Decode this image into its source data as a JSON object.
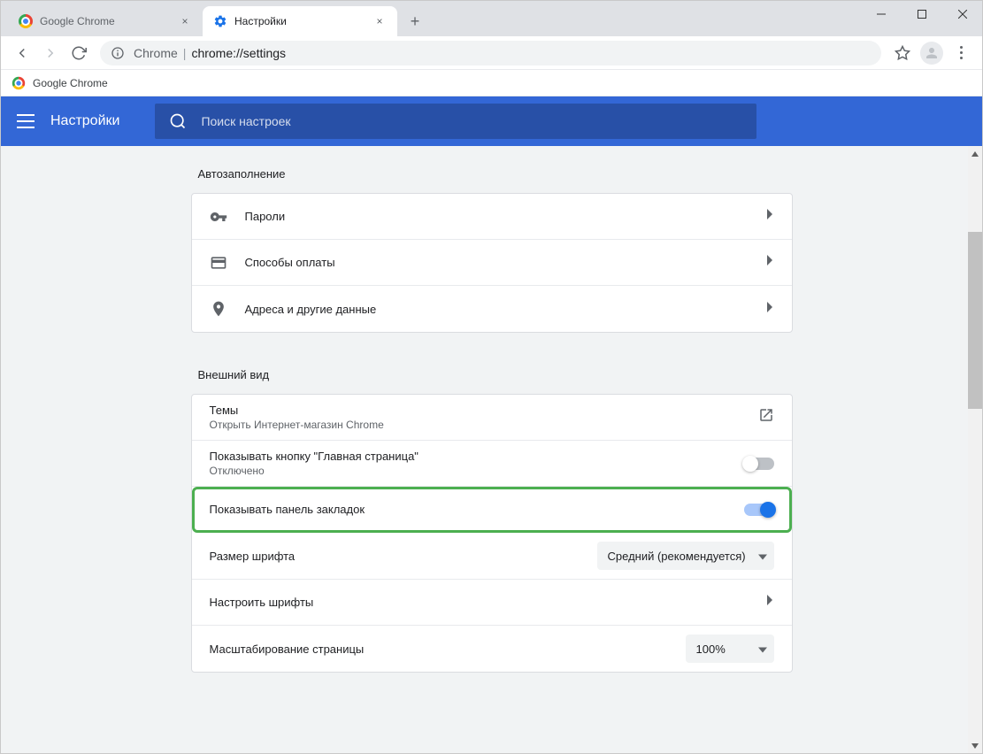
{
  "window": {
    "tabs": [
      {
        "title": "Google Chrome"
      },
      {
        "title": "Настройки"
      }
    ]
  },
  "addressbar": {
    "scheme_label": "Chrome",
    "url": "chrome://settings"
  },
  "bookmarks": {
    "item0": "Google Chrome"
  },
  "header": {
    "title": "Настройки",
    "search_placeholder": "Поиск настроек"
  },
  "sections": {
    "autofill": {
      "title": "Автозаполнение",
      "passwords": "Пароли",
      "payments": "Способы оплаты",
      "addresses": "Адреса и другие данные"
    },
    "appearance": {
      "title": "Внешний вид",
      "themes": {
        "label": "Темы",
        "sublabel": "Открыть Интернет-магазин Chrome"
      },
      "home_button": {
        "label": "Показывать кнопку \"Главная страница\"",
        "sublabel": "Отключено",
        "value": false
      },
      "bookmarks_bar": {
        "label": "Показывать панель закладок",
        "value": true
      },
      "font_size": {
        "label": "Размер шрифта",
        "value": "Средний (рекомендуется)"
      },
      "customize_fonts": "Настроить шрифты",
      "page_zoom": {
        "label": "Масштабирование страницы",
        "value": "100%"
      }
    }
  }
}
